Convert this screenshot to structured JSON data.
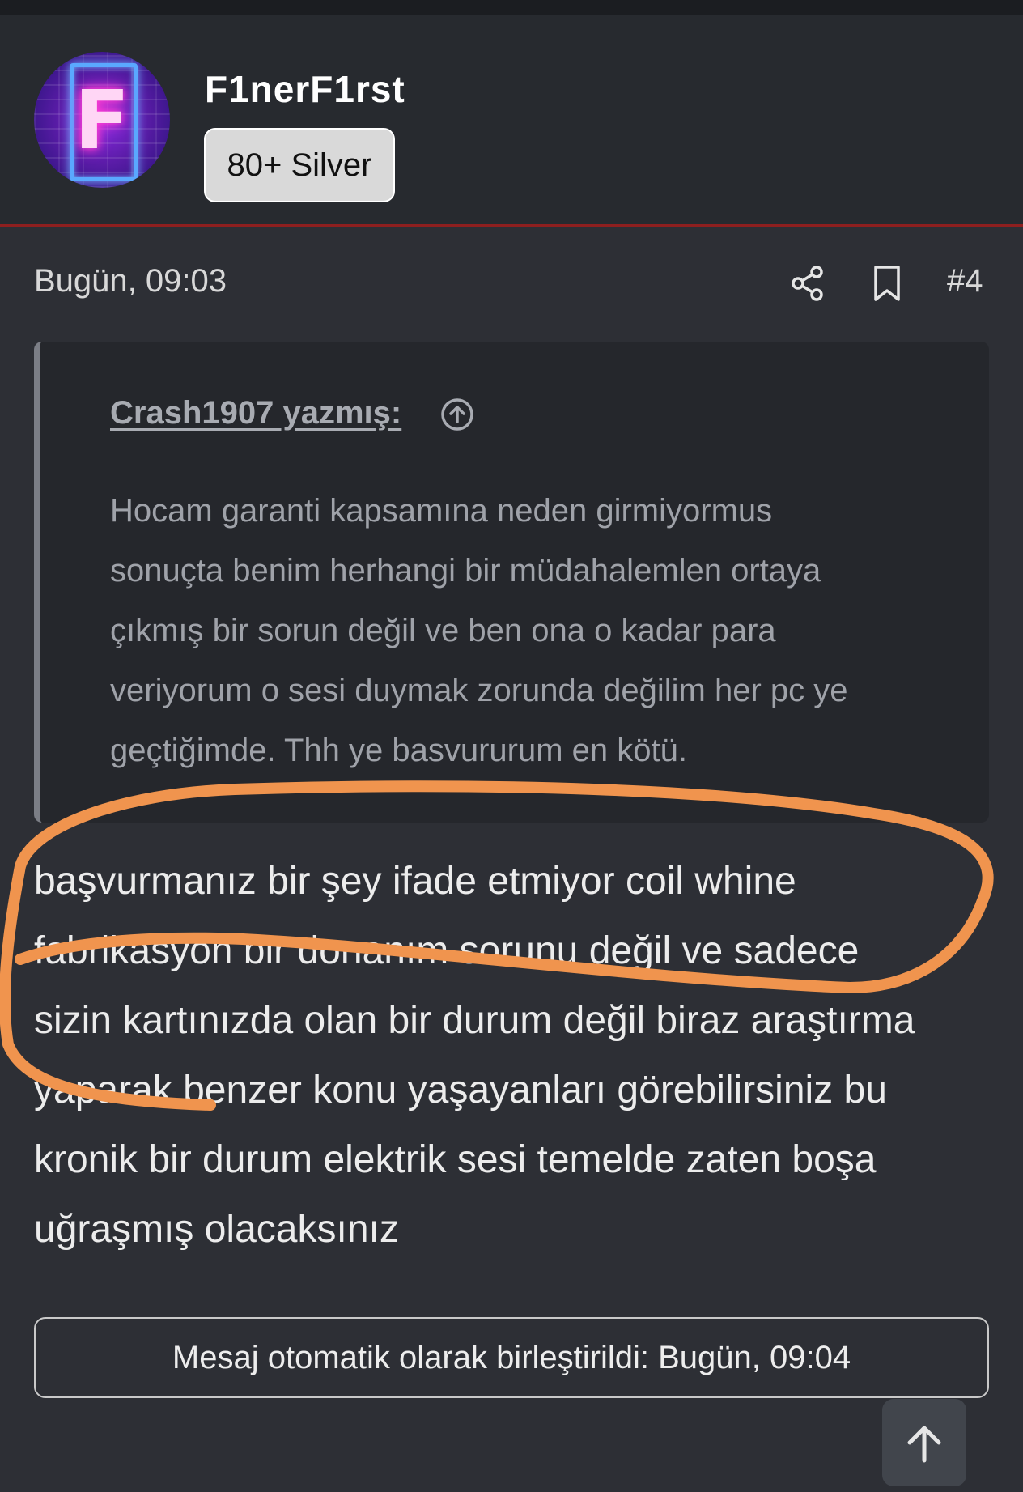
{
  "author": {
    "username": "F1nerF1rst",
    "badge": "80+ Silver",
    "avatar_letter": "F",
    "avatar_icon": "neon-letter-avatar"
  },
  "post": {
    "date": "Bugün, 09:03",
    "number": "#4",
    "share_icon": "share-icon",
    "bookmark_icon": "bookmark-icon",
    "quote": {
      "author": "Crash1907 yazmış:",
      "jump_icon": "arrow-up-circle-icon",
      "lines": [
        "Hocam garanti kapsamına neden girmiyormus",
        "sonuçta benim herhangi bir müdahalemlen ortaya",
        "çıkmış bir sorun değil ve ben ona o kadar para",
        "veriyorum o sesi duymak zorunda değilim her pc ye",
        "geçtiğimde. Thh ye basvururum en kötü."
      ]
    },
    "body_lines": [
      "başvurmanız bir şey ifade etmiyor coil whine",
      "fabrikasyon bir donanım sorunu değil ve sadece",
      "sizin kartınızda olan bir durum değil biraz araştırma",
      "yaparak benzer konu yaşayanları görebilirsiniz bu",
      "kronik bir durum elektrik sesi temelde zaten boşa",
      "uğraşmış olacaksınız"
    ],
    "merged_notice": "Mesaj otomatik olarak birleştirildi: Bugün, 09:04"
  },
  "scroll_top_icon": "arrow-up-icon",
  "colors": {
    "background": "#2d2f35",
    "header": "#272a2f",
    "accent_line": "#8e1f1f",
    "annotation": "#f0944e"
  }
}
